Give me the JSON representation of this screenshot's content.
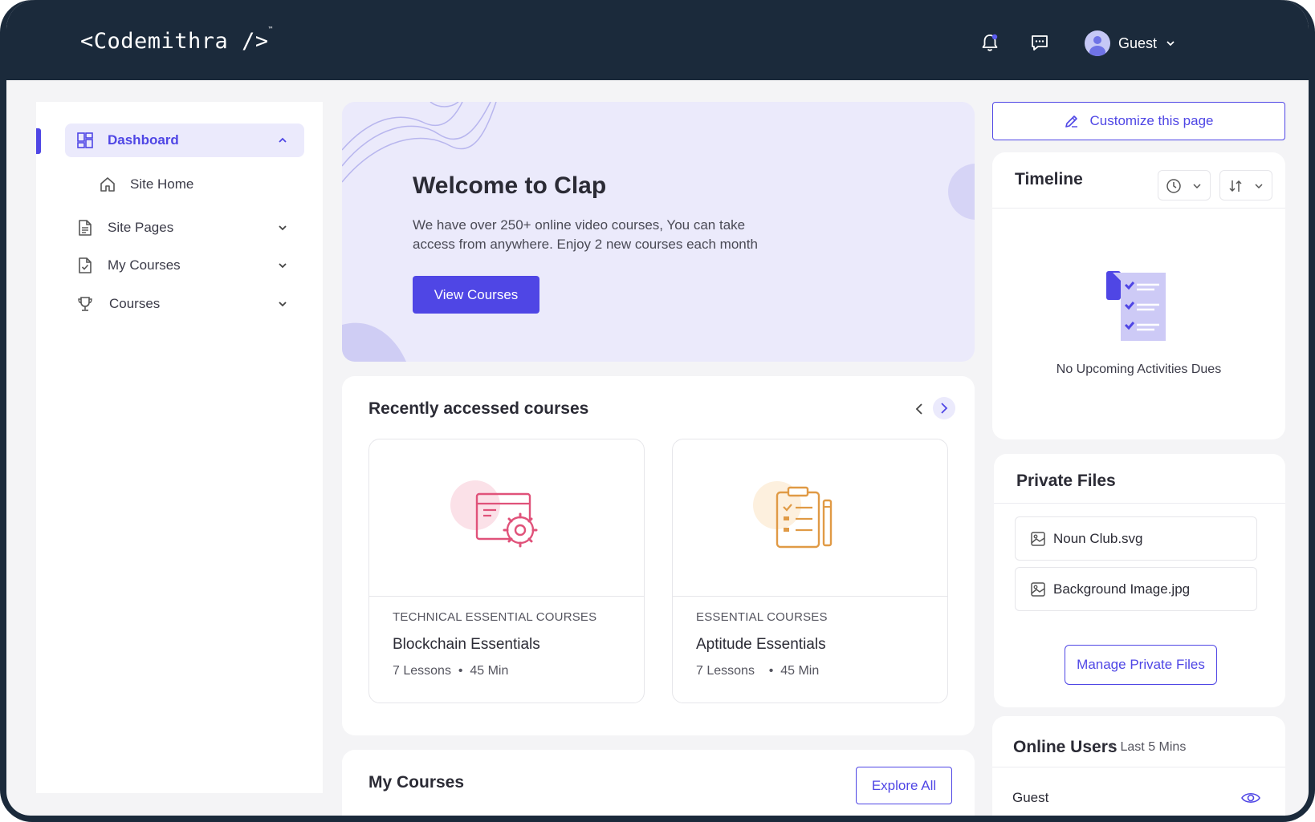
{
  "header": {
    "logo": "<Codemithra />",
    "logo_mark": "™",
    "user_name": "Guest",
    "icons": [
      "bell-icon",
      "chat-icon",
      "chevron-down-icon"
    ]
  },
  "sidebar": {
    "items": [
      {
        "label": "Dashboard",
        "icon": "dashboard-icon",
        "expanded": true
      },
      {
        "label": "Site Home",
        "icon": "home-icon"
      },
      {
        "label": "Site Pages",
        "icon": "document-icon"
      },
      {
        "label": "My Courses",
        "icon": "file-check-icon"
      },
      {
        "label": "Courses",
        "icon": "trophy-icon"
      }
    ]
  },
  "hero": {
    "title": "Welcome to Clap",
    "text": "We have over 250+ online video courses, You can take access from anywhere. Enjoy 2 new courses each month",
    "button": "View Courses"
  },
  "recent": {
    "title": "Recently accessed courses",
    "courses": [
      {
        "category": "TECHNICAL ESSENTIAL COURSES",
        "name": "Blockchain Essentials",
        "lessons": "7 Lessons",
        "duration": "45 Min",
        "accent": "#e0527a"
      },
      {
        "category": "ESSENTIAL COURSES",
        "name": "Aptitude Essentials",
        "lessons": "7 Lessons",
        "duration": "45 Min",
        "accent": "#e09a45"
      }
    ]
  },
  "my_courses": {
    "title": "My Courses",
    "button": "Explore All"
  },
  "right": {
    "customize": "Customize this page",
    "timeline": {
      "title": "Timeline",
      "empty": "No Upcoming Activities Dues"
    },
    "private_files": {
      "title": "Private Files",
      "files": [
        "Noun Club.svg",
        "Background Image.jpg"
      ],
      "button": "Manage Private Files"
    },
    "online_users": {
      "title": "Online Users",
      "subtitle": "Last 5 Mins",
      "users": [
        "Guest"
      ]
    }
  },
  "colors": {
    "accent": "#4f46e5",
    "header_bg": "#1b2a3b",
    "hero_bg": "#ebeafb"
  }
}
